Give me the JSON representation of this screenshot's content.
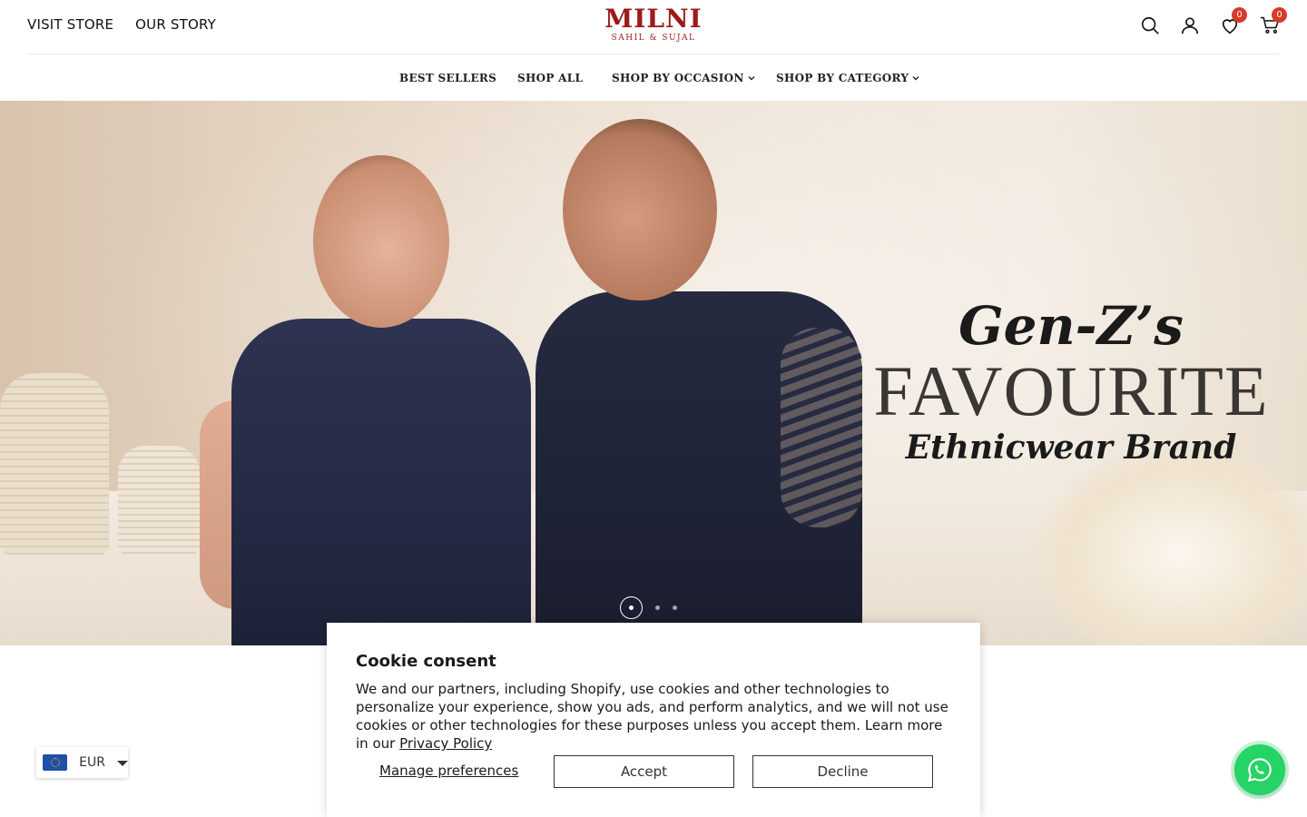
{
  "header": {
    "top_links": [
      "VISIT STORE",
      "OUR STORY"
    ],
    "logo": {
      "main": "MILNI",
      "sub": "SAHIL & SUJAL"
    },
    "wishlist_count": "0",
    "cart_count": "0"
  },
  "nav": {
    "items": [
      "BEST SELLERS",
      "SHOP ALL",
      "SHOP BY OCCASION",
      "SHOP BY CATEGORY"
    ]
  },
  "hero": {
    "line1": "Gen-Z’s",
    "line2": "FAVOURITE",
    "line3": "Ethnicwear Brand",
    "slides_total": 3,
    "active_slide": 1
  },
  "currency": {
    "code": "EUR"
  },
  "cookie": {
    "title": "Cookie consent",
    "body": "We and our partners, including Shopify, use cookies and other technologies to personalize your experience, show you ads, and perform analytics, and we will not use cookies or other technologies for these purposes unless you accept them. Learn more in our ",
    "privacy_link": "Privacy Policy",
    "manage_label": "Manage preferences",
    "accept_label": "Accept",
    "decline_label": "Decline"
  },
  "colors": {
    "brand": "#9b1b1b",
    "badge": "#d83a2a",
    "whatsapp": "#25d366"
  }
}
